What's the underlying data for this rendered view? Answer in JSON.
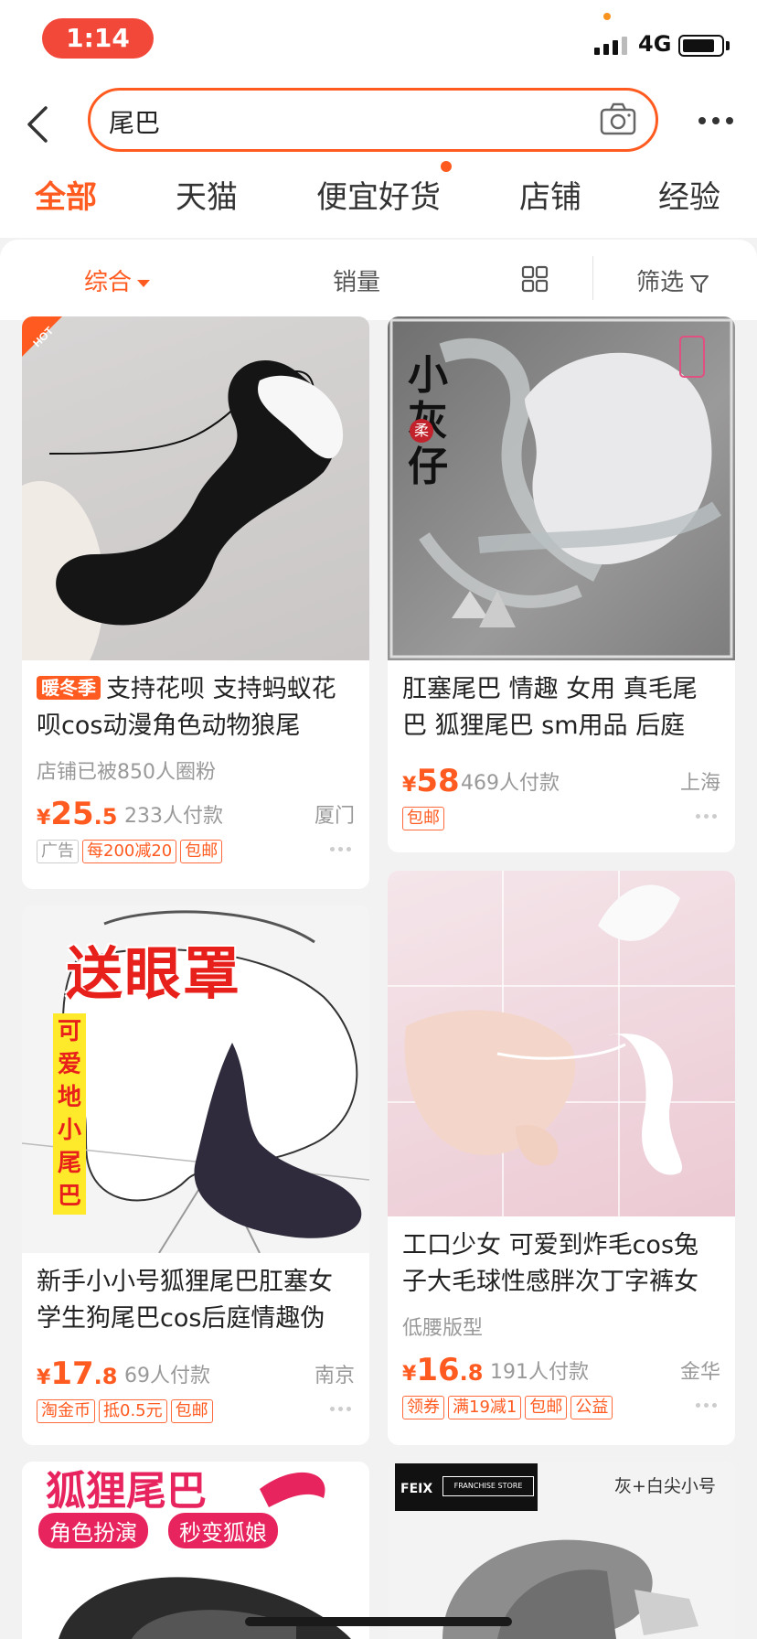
{
  "status_bar": {
    "time": "1:14",
    "network": "4G"
  },
  "search": {
    "query": "尾巴"
  },
  "tabs": [
    {
      "label": "全部",
      "active": true
    },
    {
      "label": "天猫",
      "active": false
    },
    {
      "label": "便宜好货",
      "active": false,
      "has_dot": true
    },
    {
      "label": "店铺",
      "active": false
    },
    {
      "label": "经验",
      "active": false
    }
  ],
  "sort_bar": {
    "comprehensive": "综合",
    "sales": "销量",
    "filter": "筛选"
  },
  "products": [
    {
      "hot_label": "HOT",
      "badge": "暖冬季",
      "title": "支持花呗 支持蚂蚁花呗cos动漫角色动物狼尾",
      "sub": "店铺已被850人圈粉",
      "price_symbol": "¥",
      "price_int": "25",
      "price_dec": ".5",
      "sales": "233人付款",
      "location": "厦门",
      "tags": [
        "广告",
        "每200减20",
        "包邮"
      ]
    },
    {
      "image_text": "小灰仔",
      "image_small_text": "柔",
      "title": "肛塞尾巴 情趣 女用 真毛尾巴 狐狸尾巴 sm用品 后庭",
      "price_symbol": "¥",
      "price_int": "58",
      "price_dec": "",
      "sales": "469人付款",
      "location": "上海",
      "tags": [
        "包邮"
      ]
    },
    {
      "image_headline": "送眼罩",
      "image_vertical": "可爱地小尾巴",
      "title": "新手小小号狐狸尾巴肛塞女学生狗尾巴cos后庭情趣伪",
      "price_symbol": "¥",
      "price_int": "17",
      "price_dec": ".8",
      "sales": "69人付款",
      "location": "南京",
      "tags": [
        "淘金币",
        "抵0.5元",
        "包邮"
      ]
    },
    {
      "title": "工口少女 可爱到炸毛cos兔子大毛球性感胖次丁字裤女",
      "sub": "低腰版型",
      "price_symbol": "¥",
      "price_int": "16",
      "price_dec": ".8",
      "sales": "191人付款",
      "location": "金华",
      "tags": [
        "领券",
        "满19减1",
        "包邮",
        "公益"
      ]
    },
    {
      "image_headline": "狐狸尾巴",
      "image_pills": [
        "角色扮演",
        "秒变狐娘"
      ]
    },
    {
      "brand": "FEIX",
      "brand_tag": "FRANCHISE STORE",
      "image_note": "灰+白尖小号"
    }
  ]
}
